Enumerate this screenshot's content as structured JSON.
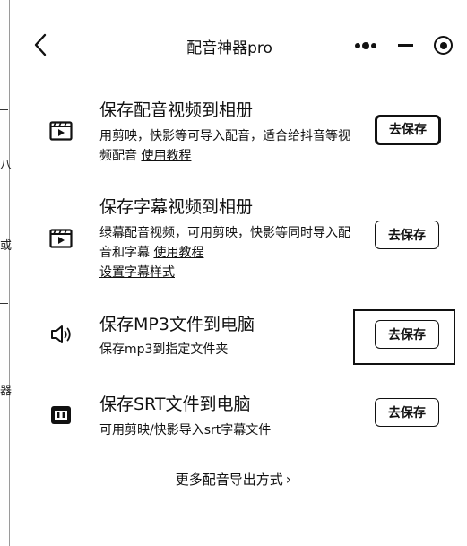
{
  "nav": {
    "title": "配音神器pro",
    "back_icon": "chevron-left-icon",
    "more_icon": "more-dots-icon",
    "minimize_icon": "minimize-icon",
    "close_icon": "target-close-icon"
  },
  "left_fragments": [
    "八",
    "或",
    "器"
  ],
  "options": [
    {
      "icon": "video-film-icon",
      "title": "保存配音视频到相册",
      "desc_text": "用剪映，快影等可导入配音，适合给抖音等视频配音",
      "desc_link": "使用教程",
      "button": "去保存"
    },
    {
      "icon": "video-film-icon",
      "title": "保存字幕视频到相册",
      "desc_text": "绿幕配音视频，可用剪映，快影等同时导入配音和字幕",
      "desc_link": "使用教程",
      "desc_link2": "设置字幕样式",
      "button": "去保存"
    },
    {
      "icon": "speaker-icon",
      "title": "保存MP3文件到电脑",
      "desc_text": "保存mp3到指定文件夹",
      "button": "去保存"
    },
    {
      "icon": "subtitle-icon",
      "title": "保存SRT文件到电脑",
      "desc_text": "可用剪映/快影导入srt字幕文件",
      "button": "去保存"
    }
  ],
  "footer": {
    "more_label": "更多配音导出方式",
    "chevron": "›"
  },
  "colors": {
    "text": "#111111",
    "background": "#ffffff",
    "edge": "#9a9a9a"
  }
}
